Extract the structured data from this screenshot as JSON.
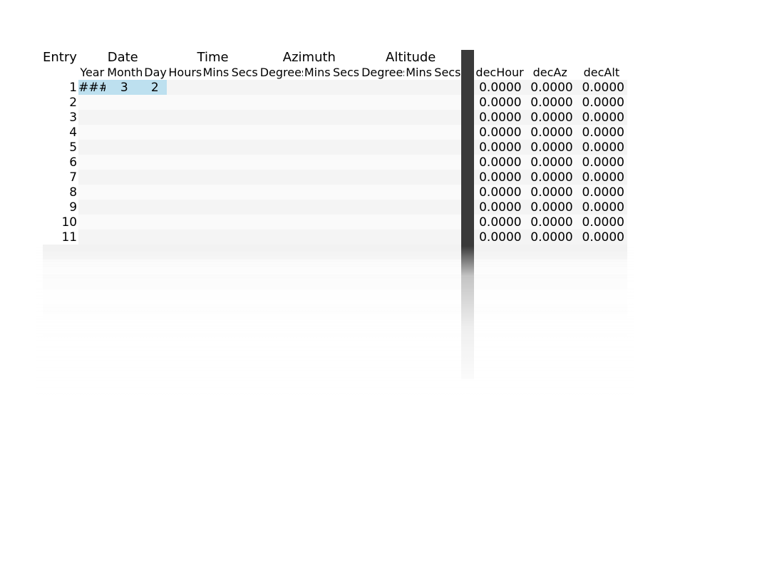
{
  "headers": {
    "entry": "Entry",
    "date": "Date",
    "time": "Time",
    "azimuth": "Azimuth",
    "altitude": "Altitude"
  },
  "subheaders": {
    "year": "Year",
    "month": "Month",
    "day": "Day",
    "hours": "Hours",
    "mins": "Mins",
    "secs": "Secs",
    "adeg": "Degrees",
    "amin": "Mins",
    "asec": "Secs",
    "aldeg": "Degrees",
    "almin": "Mins",
    "alsec": "Secs",
    "dhour": "decHour",
    "daz": "decAz",
    "dalt": "decAlt"
  },
  "rows": [
    {
      "entry": "1",
      "year": "###",
      "month": "3",
      "day": "2",
      "decHour": "0.0000",
      "decAz": "0.0000",
      "decAlt": "0.0000"
    },
    {
      "entry": "2",
      "year": "",
      "month": "",
      "day": "",
      "decHour": "0.0000",
      "decAz": "0.0000",
      "decAlt": "0.0000"
    },
    {
      "entry": "3",
      "year": "",
      "month": "",
      "day": "",
      "decHour": "0.0000",
      "decAz": "0.0000",
      "decAlt": "0.0000"
    },
    {
      "entry": "4",
      "year": "",
      "month": "",
      "day": "",
      "decHour": "0.0000",
      "decAz": "0.0000",
      "decAlt": "0.0000"
    },
    {
      "entry": "5",
      "year": "",
      "month": "",
      "day": "",
      "decHour": "0.0000",
      "decAz": "0.0000",
      "decAlt": "0.0000"
    },
    {
      "entry": "6",
      "year": "",
      "month": "",
      "day": "",
      "decHour": "0.0000",
      "decAz": "0.0000",
      "decAlt": "0.0000"
    },
    {
      "entry": "7",
      "year": "",
      "month": "",
      "day": "",
      "decHour": "0.0000",
      "decAz": "0.0000",
      "decAlt": "0.0000"
    },
    {
      "entry": "8",
      "year": "",
      "month": "",
      "day": "",
      "decHour": "0.0000",
      "decAz": "0.0000",
      "decAlt": "0.0000"
    },
    {
      "entry": "9",
      "year": "",
      "month": "",
      "day": "",
      "decHour": "0.0000",
      "decAz": "0.0000",
      "decAlt": "0.0000"
    },
    {
      "entry": "10",
      "year": "",
      "month": "",
      "day": "",
      "decHour": "0.0000",
      "decAz": "0.0000",
      "decAlt": "0.0000"
    },
    {
      "entry": "11",
      "year": "",
      "month": "",
      "day": "",
      "decHour": "0.0000",
      "decAz": "0.0000",
      "decAlt": "0.0000"
    }
  ]
}
